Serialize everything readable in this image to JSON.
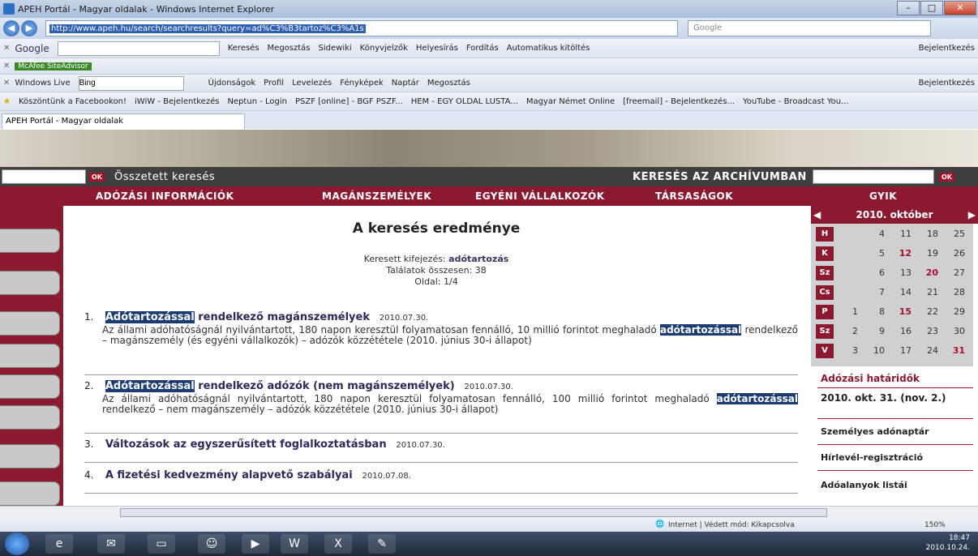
{
  "window": {
    "title": "APEH Portál - Magyar oldalak - Windows Internet Explorer",
    "min": "–",
    "max": "□",
    "close": "✕"
  },
  "address": {
    "url": "http://www.apeh.hu/search/searchresults?query=ad%C3%B3tartoz%C3%A1s",
    "search_placeholder": "Google"
  },
  "google_bar": {
    "label": "Google",
    "items": [
      "Keresés",
      "Megosztás",
      "Sidewiki",
      "Könyvjelzők",
      "Helyesírás",
      "Fordítás",
      "Automatikus kitöltés"
    ],
    "signin": "Bejelentkezés"
  },
  "mcafee": {
    "label": "McAfee SiteAdvisor"
  },
  "live_bar": {
    "label": "Windows Live",
    "search_value": "Bing",
    "items": [
      "Újdonságok",
      "Profil",
      "Levelezés",
      "Fényképek",
      "Naptár",
      "Megosztás"
    ],
    "signin": "Bejelentkezés"
  },
  "favorites": [
    "Köszöntünk a Facebookon!",
    "iWiW - Bejelentkezés",
    "Neptun - Login",
    "PSZF [online] - BGF PSZF...",
    "HEM - EGY OLDAL LUSTA...",
    "Magyar Német Online",
    "[freemail] - Bejelentkezés...",
    "YouTube - Broadcast You..."
  ],
  "tab": {
    "label": "APEH Portál - Magyar oldalak"
  },
  "site": {
    "ok": "OK",
    "complex_search": "Összetett keresés",
    "archive_search": "KERESÉS AZ ARCHÍVUMBAN",
    "menu": [
      "ADÓZÁSI INFORMÁCIÓK",
      "MAGÁNSZEMÉLYEK",
      "EGYÉNI VÁLLALKOZÓK",
      "TÁRSASÁGOK",
      "GYIK"
    ]
  },
  "results": {
    "title": "A keresés eredménye",
    "query_label": "Keresett kifejezés:",
    "query_value": "adótartozás",
    "count_line": "Találatok összesen: 38",
    "page_line": "Oldal: 1/4",
    "items": [
      {
        "num": "1.",
        "hl": "Adótartozással",
        "rest": " rendelkező magánszemélyek",
        "date": "2010.07.30.",
        "desc_a": "Az állami adóhatóságnál nyilvántartott, 180 napon keresztül folyamatosan fennálló, 10 millió forintot meghaladó ",
        "desc_hl": "adótartozással",
        "desc_b": " rendelkező – magánszemély (és egyéni vállalkozók) – adózók közzététele (2010. június 30-i állapot)"
      },
      {
        "num": "2.",
        "hl": "Adótartozással",
        "rest": " rendelkező adózók (nem magánszemélyek)",
        "date": "2010.07.30.",
        "desc_a": "Az állami adóhatóságnál nyilvántartott, 180 napon keresztül folyamatosan fennálló, 100 millió forintot meghaladó ",
        "desc_hl": "adótartozással",
        "desc_b": " rendelkező – nem magánszemély – adózók közzététele (2010. június 30-i állapot)"
      },
      {
        "num": "3.",
        "title": "Változások az egyszerűsített foglalkoztatásban",
        "date": "2010.07.30."
      },
      {
        "num": "4.",
        "title": "A fizetési kedvezmény alapvető szabályai",
        "date": "2010.07.08."
      }
    ]
  },
  "calendar": {
    "month": "2010. október",
    "days": [
      "H",
      "K",
      "Sz",
      "Cs",
      "P",
      "Sz",
      "V"
    ],
    "weeks": [
      [
        "",
        "",
        "",
        "",
        "1",
        "2",
        "3"
      ],
      [
        "4",
        "5",
        "6",
        "7",
        "8",
        "9",
        "10"
      ],
      [
        "11",
        "12",
        "13",
        "14",
        "15",
        "16",
        "17"
      ],
      [
        "18",
        "19",
        "20",
        "21",
        "22",
        "23",
        "24"
      ],
      [
        "25",
        "26",
        "27",
        "28",
        "29",
        "30",
        "31"
      ]
    ],
    "red": [
      "12",
      "15",
      "20",
      "31"
    ]
  },
  "sidebar": {
    "deadlines_title": "Adózási határidők",
    "deadline": "2010. okt. 31. (nov. 2.)",
    "links": [
      "Személyes adónaptár",
      "Hírlevél-regisztráció",
      "Adóalanyok listái"
    ]
  },
  "status": {
    "zone": "Internet | Védett mód: Kikapcsolva",
    "zoom": "150%"
  },
  "clock": {
    "time": "18:47",
    "date": "2010.10.24."
  }
}
